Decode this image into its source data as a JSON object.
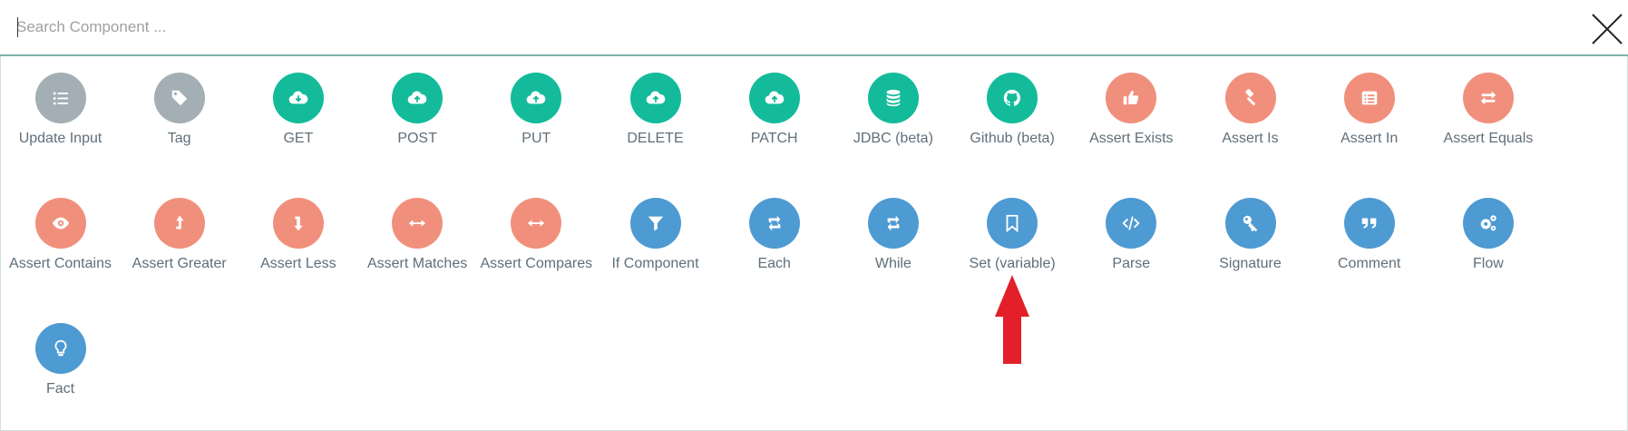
{
  "search": {
    "placeholder": "Search Component ..."
  },
  "colors": {
    "gray": "#a3aeb5",
    "green": "#13bb9a",
    "salmon": "#f0907c",
    "blue": "#4e9ad2",
    "arrow": "#e3202a"
  },
  "components": [
    {
      "label": "Update Input",
      "color": "gray",
      "icon": "list-icon"
    },
    {
      "label": "Tag",
      "color": "gray",
      "icon": "tag-icon"
    },
    {
      "label": "GET",
      "color": "green",
      "icon": "cloud-download-icon"
    },
    {
      "label": "POST",
      "color": "green",
      "icon": "cloud-upload-icon"
    },
    {
      "label": "PUT",
      "color": "green",
      "icon": "cloud-upload-icon"
    },
    {
      "label": "DELETE",
      "color": "green",
      "icon": "cloud-upload-icon"
    },
    {
      "label": "PATCH",
      "color": "green",
      "icon": "cloud-upload-icon"
    },
    {
      "label": "JDBC (beta)",
      "color": "green",
      "icon": "database-icon"
    },
    {
      "label": "Github (beta)",
      "color": "green",
      "icon": "github-icon"
    },
    {
      "label": "Assert Exists",
      "color": "salmon",
      "icon": "thumbs-up-icon"
    },
    {
      "label": "Assert Is",
      "color": "salmon",
      "icon": "gavel-icon"
    },
    {
      "label": "Assert In",
      "color": "salmon",
      "icon": "list-alt-icon"
    },
    {
      "label": "Assert Equals",
      "color": "salmon",
      "icon": "exchange-icon"
    },
    {
      "label": "Assert Contains",
      "color": "salmon",
      "icon": "eye-icon"
    },
    {
      "label": "Assert Greater",
      "color": "salmon",
      "icon": "level-up-icon"
    },
    {
      "label": "Assert Less",
      "color": "salmon",
      "icon": "level-down-icon"
    },
    {
      "label": "Assert Matches",
      "color": "salmon",
      "icon": "arrows-h-icon"
    },
    {
      "label": "Assert Compares",
      "color": "salmon",
      "icon": "arrows-h-icon"
    },
    {
      "label": "If Component",
      "color": "blue",
      "icon": "filter-icon"
    },
    {
      "label": "Each",
      "color": "blue",
      "icon": "retweet-icon"
    },
    {
      "label": "While",
      "color": "blue",
      "icon": "retweet-icon"
    },
    {
      "label": "Set (variable)",
      "color": "blue",
      "icon": "bookmark-icon"
    },
    {
      "label": "Parse",
      "color": "blue",
      "icon": "code-icon"
    },
    {
      "label": "Signature",
      "color": "blue",
      "icon": "key-icon"
    },
    {
      "label": "Comment",
      "color": "blue",
      "icon": "quote-icon"
    },
    {
      "label": "Flow",
      "color": "blue",
      "icon": "gears-icon"
    },
    {
      "label": "Fact",
      "color": "blue",
      "icon": "lightbulb-icon"
    }
  ]
}
